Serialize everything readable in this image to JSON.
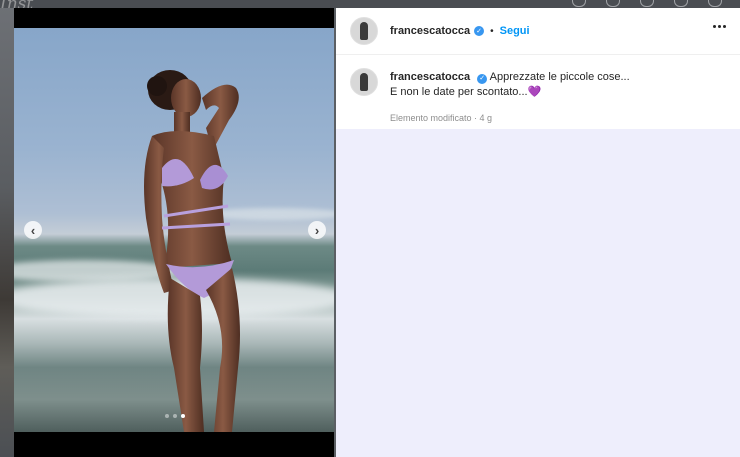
{
  "background": {
    "logo_text": "Inst"
  },
  "post": {
    "username": "francescatocca",
    "follow_label": "Segui",
    "separator": "•",
    "caption_line1": "Apprezzate le piccole cose...",
    "caption_line2": "E non le date per scontato...",
    "caption_emoji": "💜",
    "meta": "Elemento modificato · 4 g",
    "carousel": {
      "total_slides": 3,
      "active_slide": 3
    }
  },
  "colors": {
    "accent_link": "#0095f6",
    "verified_badge": "#3897f0",
    "panel_bg": "#eeeefc",
    "overlay_bg": "#5b5f64"
  },
  "icons": {
    "verified": "verified-badge-icon",
    "more": "more-options-icon",
    "prev": "chevron-left-icon",
    "next": "chevron-right-icon"
  }
}
